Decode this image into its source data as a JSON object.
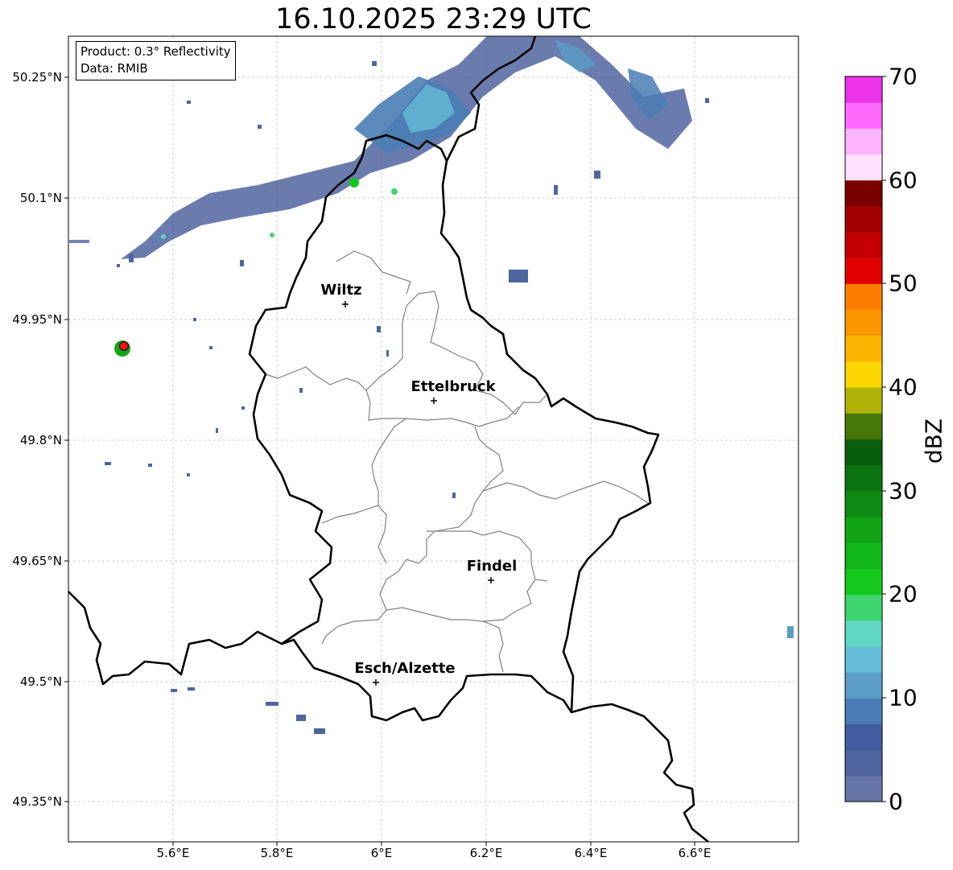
{
  "title": "16.10.2025 23:29 UTC",
  "info": {
    "product": "Product: 0.3° Reflectivity",
    "data": "Data: RMIB"
  },
  "lat_ticks": [
    "50.25°N",
    "50.1°N",
    "49.95°N",
    "49.8°N",
    "49.65°N",
    "49.5°N",
    "49.35°N"
  ],
  "lon_ticks": [
    "5.6°E",
    "5.8°E",
    "6°E",
    "6.2°E",
    "6.4°E",
    "6.6°E"
  ],
  "cities": [
    {
      "name": "Wiltz"
    },
    {
      "name": "Ettelbruck"
    },
    {
      "name": "Findel"
    },
    {
      "name": "Esch/Alzette"
    }
  ],
  "colorbar": {
    "label": "dBZ",
    "ticks": [
      "0",
      "10",
      "20",
      "30",
      "40",
      "50",
      "60",
      "70"
    ],
    "colors": [
      "#6577a8",
      "#50659f",
      "#415ca0",
      "#4a7db4",
      "#5a9ec6",
      "#65bcd8",
      "#60d6c4",
      "#3ed470",
      "#14c81c",
      "#11b61a",
      "#11a514",
      "#0f8a12",
      "#0b7410",
      "#075e0b",
      "#467708",
      "#afb307",
      "#fbd600",
      "#fbb400",
      "#fb9700",
      "#fb7e00",
      "#e30000",
      "#c40000",
      "#a20000",
      "#7a0000",
      "#fee1fe",
      "#feb3fe",
      "#fd68fd",
      "#ea33ea"
    ]
  },
  "colors": {
    "border": "#000000",
    "canton": "#808080",
    "grid": "#bfbfbf",
    "radar_site": "#ee1111"
  }
}
